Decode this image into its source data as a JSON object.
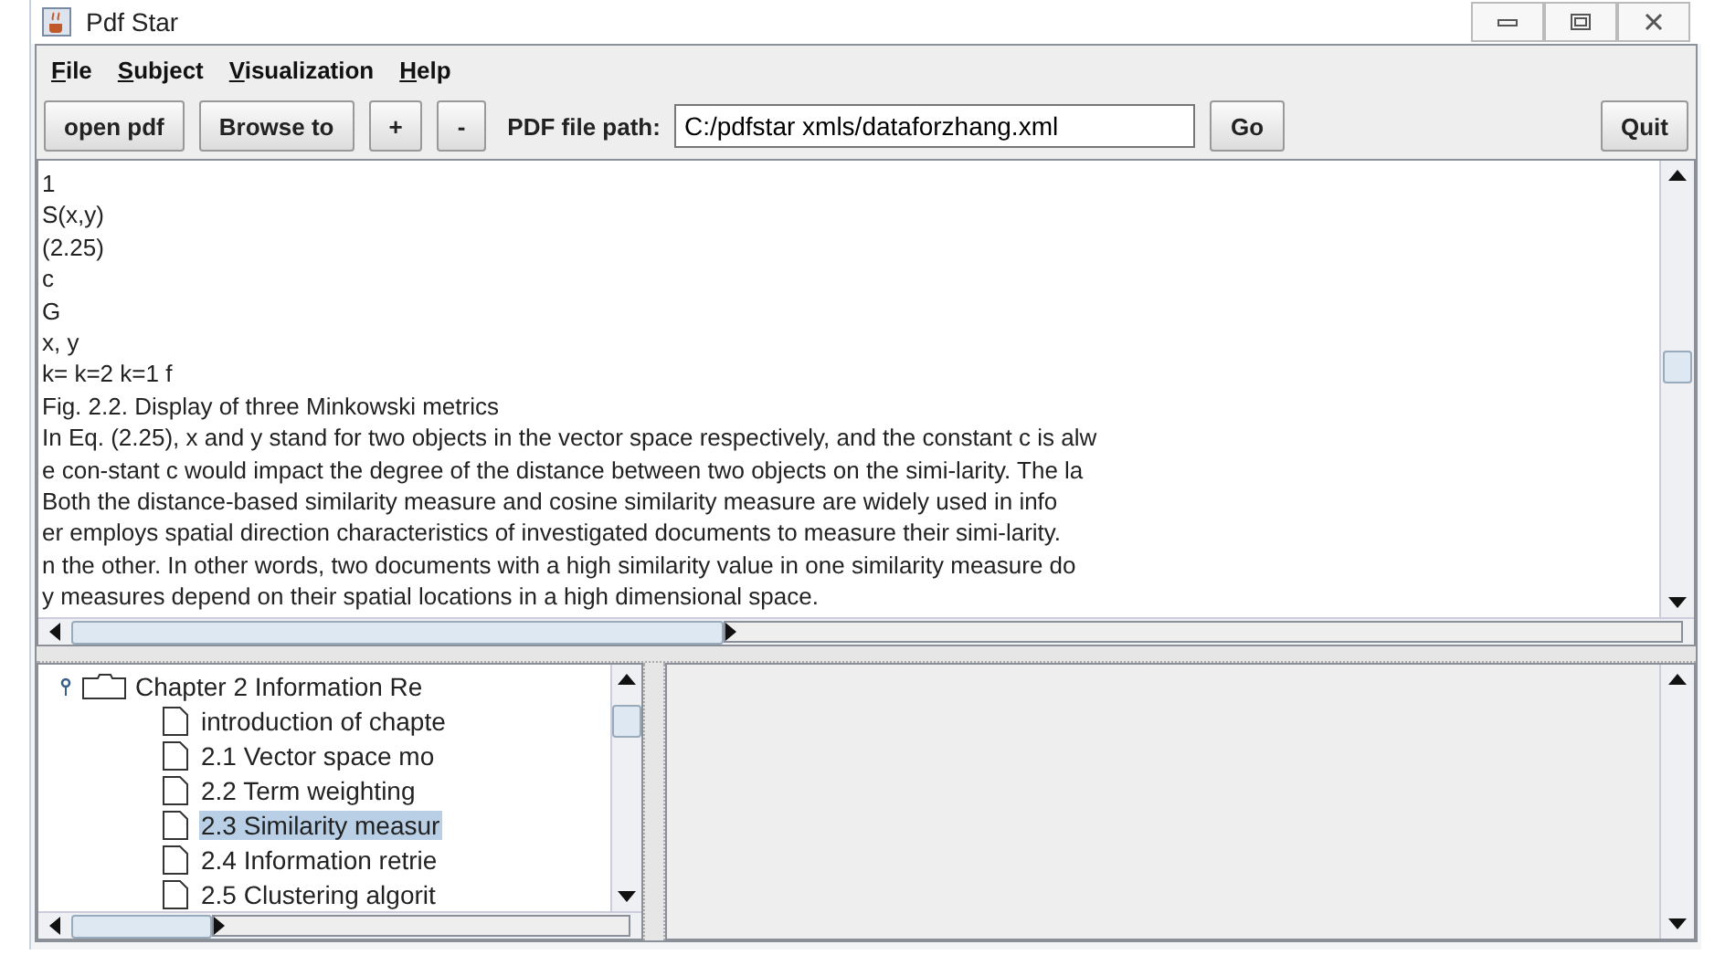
{
  "window": {
    "title": "Pdf Star"
  },
  "menu": [
    {
      "label": "File"
    },
    {
      "label": "Subject"
    },
    {
      "label": "Visualization"
    },
    {
      "label": "Help"
    }
  ],
  "toolbar": {
    "buttons_left": [
      "open pdf",
      "Browse to",
      "+",
      "-"
    ],
    "path_label": "PDF file path:",
    "path_value": "C:/pdfstar xmls/dataforzhang.xml",
    "buttons_right": [
      "Go",
      "Quit"
    ]
  },
  "document_lines": [
    "1",
    "S(x,y)",
    "(2.25)",
    "c",
    "G",
    "x, y",
    "k= k=2 k=1 f",
    "Fig. 2.2. Display of three Minkowski metrics",
    "In Eq. (2.25), x and y stand for two objects in the vector space respectively, and the constant c is alw",
    "e con-stant c would impact the degree of the distance between two objects on the simi-larity. The la",
    "Both the distance-based similarity measure and cosine similarity measure are widely used in info",
    "er employs spatial direction characteristics of investigated documents to measure their simi-larity.",
    "n the other. In other words, two documents with a high similarity value in one similarity measure do",
    "y measures depend on their spatial locations in a high dimensional space."
  ],
  "tree": [
    {
      "label": "Chapter 2 Information Re",
      "expanded": true,
      "selected": false,
      "children": [
        {
          "label": "introduction of chapte",
          "selected": false
        },
        {
          "label": "2.1 Vector space mo",
          "selected": false
        },
        {
          "label": "2.2 Term weighting",
          "selected": false
        },
        {
          "label": "2.3 Similarity measur",
          "selected": true
        },
        {
          "label": "2.4 Information retrie",
          "selected": false
        },
        {
          "label": "2.5 Clustering algorit",
          "selected": false
        }
      ]
    }
  ]
}
